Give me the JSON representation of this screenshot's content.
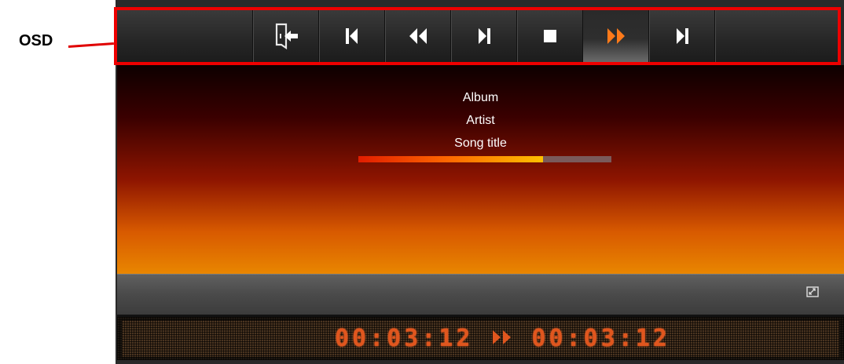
{
  "callout": {
    "label": "OSD",
    "color": "#e00000"
  },
  "toolbar": {
    "buttons": [
      {
        "name": "exit",
        "icon": "exit-door-icon"
      },
      {
        "name": "previous",
        "icon": "skip-previous-icon"
      },
      {
        "name": "rewind",
        "icon": "rewind-icon"
      },
      {
        "name": "play",
        "icon": "play-icon"
      },
      {
        "name": "stop",
        "icon": "stop-icon"
      },
      {
        "name": "fast-forward",
        "icon": "fast-forward-icon",
        "active": true
      },
      {
        "name": "next",
        "icon": "skip-next-icon"
      }
    ],
    "active_color": "#ff7a1a"
  },
  "now_playing": {
    "album": "Album",
    "artist": "Artist",
    "song_title": "Song title",
    "progress": 0.73
  },
  "display": {
    "elapsed": "00:03:12",
    "total": "00:03:12",
    "state_icon": "fast-forward-icon"
  },
  "mid_bar": {
    "icon": "fullscreen-toggle-icon"
  }
}
